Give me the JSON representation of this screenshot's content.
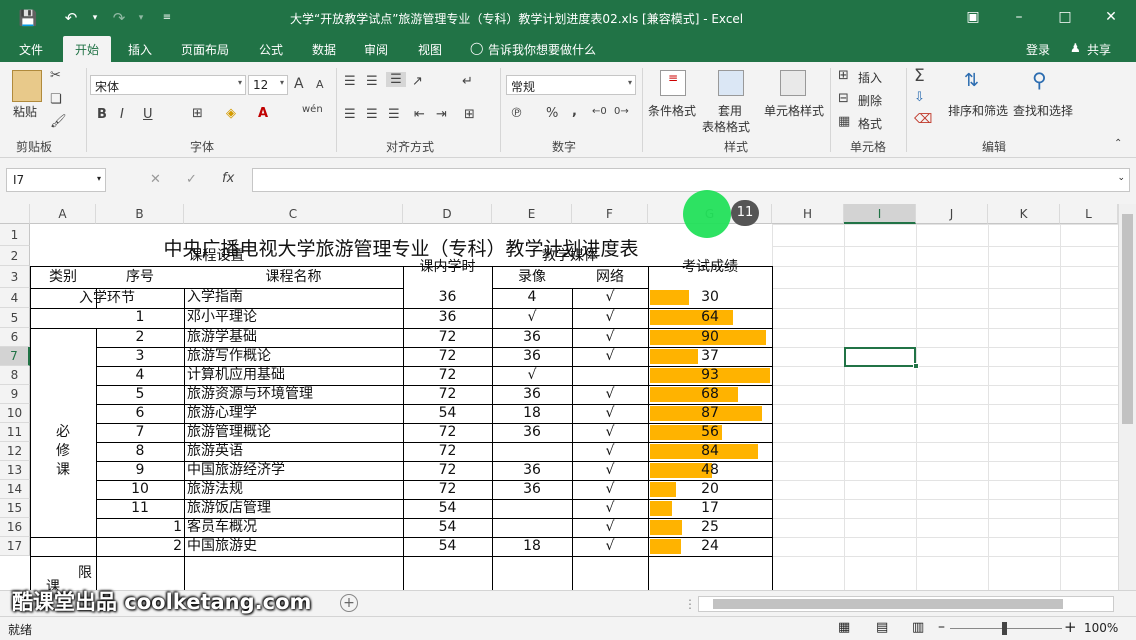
{
  "window": {
    "title": "大学“开放教学试点”旅游管理专业（专科）教学计划进度表02.xls  [兼容模式] - Excel",
    "quick_access": [
      "save-icon",
      "undo-icon",
      "redo-icon",
      "customize-icon"
    ]
  },
  "tabs": {
    "items": [
      "文件",
      "开始",
      "插入",
      "页面布局",
      "公式",
      "数据",
      "审阅",
      "视图"
    ],
    "tell_me": "告诉我你想要做什么",
    "login": "登录",
    "share": "共享"
  },
  "ribbon": {
    "clipboard": {
      "paste": "粘贴",
      "label": "剪贴板"
    },
    "font": {
      "name": "宋体",
      "size": "12",
      "label": "字体",
      "bold": "B",
      "italic": "I",
      "underline": "U",
      "grow": "A",
      "shrink": "A",
      "pinyin": "wén"
    },
    "alignment": {
      "label": "对齐方式"
    },
    "number": {
      "format": "常规",
      "label": "数字",
      "percent": "%",
      "comma": ","
    },
    "styles": {
      "conditional": "条件格式",
      "table_1": "套用",
      "table_2": "表格格式",
      "cell_styles": "单元格样式",
      "label": "样式"
    },
    "cells": {
      "insert": "插入",
      "delete": "删除",
      "format": "格式",
      "label": "单元格"
    },
    "editing": {
      "sort_filter": "排序和筛选",
      "find_select": "查找和选择",
      "label": "编辑"
    }
  },
  "formula_bar": {
    "name_box": "I7",
    "fx": "fx",
    "value": ""
  },
  "columns": [
    "A",
    "B",
    "C",
    "D",
    "E",
    "F",
    "G",
    "H",
    "I",
    "J",
    "K",
    "L"
  ],
  "rows": [
    "1",
    "2",
    "3",
    "4",
    "5",
    "6",
    "7",
    "8",
    "9",
    "10",
    "11",
    "12",
    "13",
    "14",
    "15",
    "16",
    "17"
  ],
  "sheet": {
    "title": "中央广播电视大学旅游管理专业（专科）教学计划进度表",
    "h_course_setup": "课程设置",
    "h_hours": "课内学时",
    "h_media": "教学媒体",
    "h_score": "考试成绩",
    "h_category": "类别",
    "h_seq": "序号",
    "h_name": "课程名称",
    "h_video": "录像",
    "h_network": "网络",
    "intro_category": "入学环节",
    "required_category": [
      "必",
      "修",
      "课"
    ],
    "limited_category": [
      "限",
      "课"
    ],
    "data_rows": [
      {
        "seq": "",
        "name": "入学指南",
        "hours": "36",
        "video": "4",
        "net": "√",
        "score": "30",
        "score_value": 30
      },
      {
        "seq": "1",
        "name": "邓小平理论",
        "hours": "36",
        "video": "√",
        "net": "√",
        "score": "64",
        "score_value": 64
      },
      {
        "seq": "2",
        "name": "旅游学基础",
        "hours": "72",
        "video": "36",
        "net": "√",
        "score": "90",
        "score_value": 90
      },
      {
        "seq": "3",
        "name": "旅游写作概论",
        "hours": "72",
        "video": "36",
        "net": "√",
        "score": "37",
        "score_value": 37
      },
      {
        "seq": "4",
        "name": "计算机应用基础",
        "hours": "72",
        "video": "√",
        "net": "",
        "score": "93",
        "score_value": 93
      },
      {
        "seq": "5",
        "name": "旅游资源与环境管理",
        "hours": "72",
        "video": "36",
        "net": "√",
        "score": "68",
        "score_value": 68
      },
      {
        "seq": "6",
        "name": "旅游心理学",
        "hours": "54",
        "video": "18",
        "net": "√",
        "score": "87",
        "score_value": 87
      },
      {
        "seq": "7",
        "name": "旅游管理概论",
        "hours": "72",
        "video": "36",
        "net": "√",
        "score": "56",
        "score_value": 56
      },
      {
        "seq": "8",
        "name": "旅游英语",
        "hours": "72",
        "video": "",
        "net": "√",
        "score": "84",
        "score_value": 84
      },
      {
        "seq": "9",
        "name": "中国旅游经济学",
        "hours": "72",
        "video": "36",
        "net": "√",
        "score": "48",
        "score_value": 48
      },
      {
        "seq": "10",
        "name": "旅游法规",
        "hours": "72",
        "video": "36",
        "net": "√",
        "score": "20",
        "score_value": 20
      },
      {
        "seq": "11",
        "name": "旅游饭店管理",
        "hours": "54",
        "video": "",
        "net": "√",
        "score": "17",
        "score_value": 17
      },
      {
        "seq": "1",
        "name": "客员车概况",
        "hours": "54",
        "video": "",
        "net": "√",
        "score": "25",
        "score_value": 25
      },
      {
        "seq": "2",
        "name": "中国旅游史",
        "hours": "54",
        "video": "18",
        "net": "√",
        "score": "24",
        "score_value": 24
      }
    ],
    "score_max": 93
  },
  "cursor_badge": "11",
  "status": {
    "ready": "就绪",
    "zoom": "100%"
  },
  "watermark": "酷课堂出品 coolketang.com",
  "colors": {
    "accent": "#217346",
    "databar": "#ffb300",
    "cursor": "#22e05a"
  }
}
